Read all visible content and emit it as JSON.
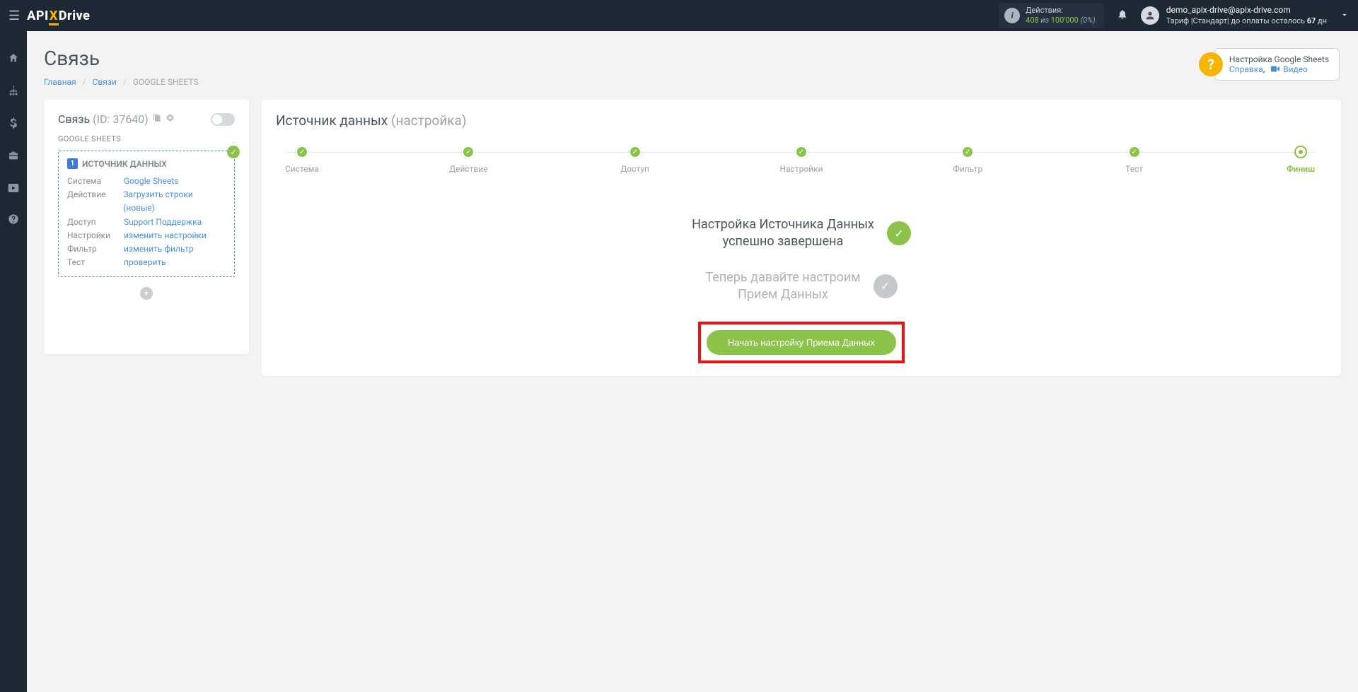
{
  "topbar": {
    "logo_pre": "API",
    "logo_x": "X",
    "logo_post": "Drive",
    "actions_label": "Действия:",
    "actions_n1": "408",
    "actions_iz": "из",
    "actions_n2": "100'000",
    "actions_pct": "(0%)",
    "email": "demo_apix-drive@apix-drive.com",
    "tariff_prefix": "Тариф |Стандарт| до оплаты осталось ",
    "tariff_days": "67",
    "tariff_suffix": " дн"
  },
  "page": {
    "title": "Связь",
    "breadcrumbs": {
      "home": "Главная",
      "links": "Связи",
      "current": "GOOGLE SHEETS"
    }
  },
  "left_card": {
    "title": "Связь",
    "id_label": "(ID: 37640)",
    "sub": "GOOGLE SHEETS",
    "source_head": "ИСТОЧНИК ДАННЫХ",
    "rows": [
      {
        "k": "Система",
        "v": "Google Sheets"
      },
      {
        "k": "Действие",
        "v": "Загрузить строки (новые)"
      },
      {
        "k": "Доступ",
        "v": "Support Поддержка"
      },
      {
        "k": "Настройки",
        "v": "изменить настройки"
      },
      {
        "k": "Фильтр",
        "v": "изменить фильтр"
      },
      {
        "k": "Тест",
        "v": "проверить"
      }
    ]
  },
  "right_card": {
    "title_strong": "Источник данных",
    "title_muted": "(настройка)",
    "steps": [
      "Система",
      "Действие",
      "Доступ",
      "Настройки",
      "Фильтр",
      "Тест",
      "Финиш"
    ],
    "status_done_l1": "Настройка Источника Данных",
    "status_done_l2": "успешно завершена",
    "status_next_l1": "Теперь давайте настроим",
    "status_next_l2": "Прием Данных",
    "cta": "Начать настройку Приема Данных"
  },
  "help": {
    "title": "Настройка Google Sheets",
    "link1": "Справка",
    "link2": "Видео"
  }
}
